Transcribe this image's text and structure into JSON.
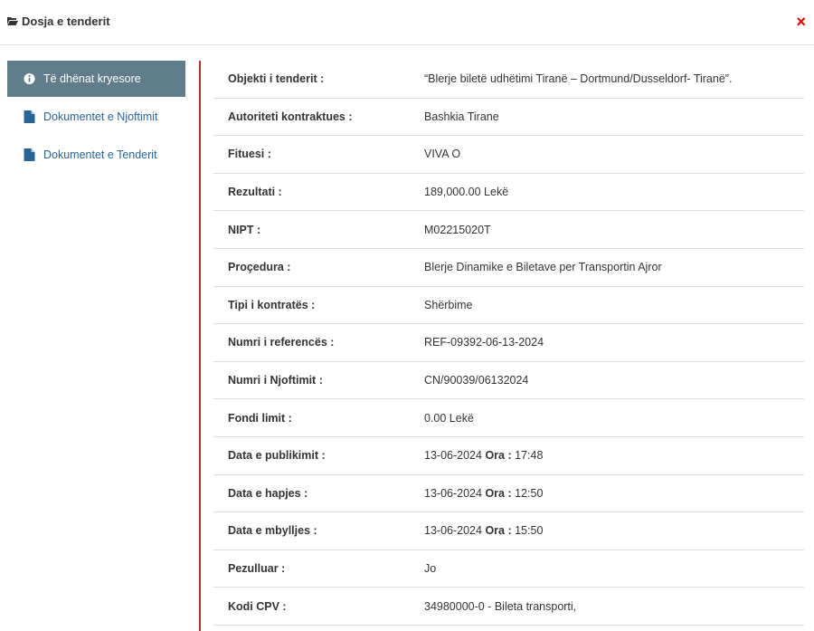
{
  "header": {
    "title": "Dosja e tenderit",
    "close_icon": "×"
  },
  "sidebar": {
    "items": [
      {
        "label": "Të dhënat kryesore",
        "icon": "info-icon"
      },
      {
        "label": "Dokumentet e Njoftimit",
        "icon": "document-icon"
      },
      {
        "label": "Dokumentet e Tenderit",
        "icon": "document-icon"
      }
    ]
  },
  "details": [
    {
      "label": "Objekti i tenderit :",
      "value": "“Blerje biletë udhëtimi Tiranë – Dortmund/Dusseldorf- Tiranë”."
    },
    {
      "label": "Autoriteti kontraktues :",
      "value": "Bashkia Tirane"
    },
    {
      "label": "Fituesi :",
      "value": "VIVA O"
    },
    {
      "label": "Rezultati :",
      "value": "189,000.00 Lekë"
    },
    {
      "label": "NIPT :",
      "value": "M02215020T"
    },
    {
      "label": "Proçedura :",
      "value": "Blerje Dinamike e Biletave per Transportin Ajror"
    },
    {
      "label": "Tipi i kontratës :",
      "value": "Shërbime"
    },
    {
      "label": "Numri i referencës :",
      "value": "REF-09392-06-13-2024"
    },
    {
      "label": "Numri i Njoftimit :",
      "value": "CN/90039/06132024"
    },
    {
      "label": "Fondi limit :",
      "value": "0.00 Lekë"
    },
    {
      "label": "Data e publikimit :",
      "date": "13-06-2024",
      "ora_label": "Ora :",
      "time": "17:48"
    },
    {
      "label": "Data e hapjes :",
      "date": "13-06-2024",
      "ora_label": "Ora :",
      "time": "12:50"
    },
    {
      "label": "Data e mbylljes :",
      "date": "13-06-2024",
      "ora_label": "Ora :",
      "time": "15:50"
    },
    {
      "label": "Pezulluar :",
      "value": "Jo"
    },
    {
      "label": "Kodi CPV :",
      "value": "34980000-0 - Bileta transporti,"
    }
  ],
  "colors": {
    "active_bg": "#617d8c",
    "link": "#2a6496",
    "close": "#e00000",
    "divider": "#b03030"
  }
}
